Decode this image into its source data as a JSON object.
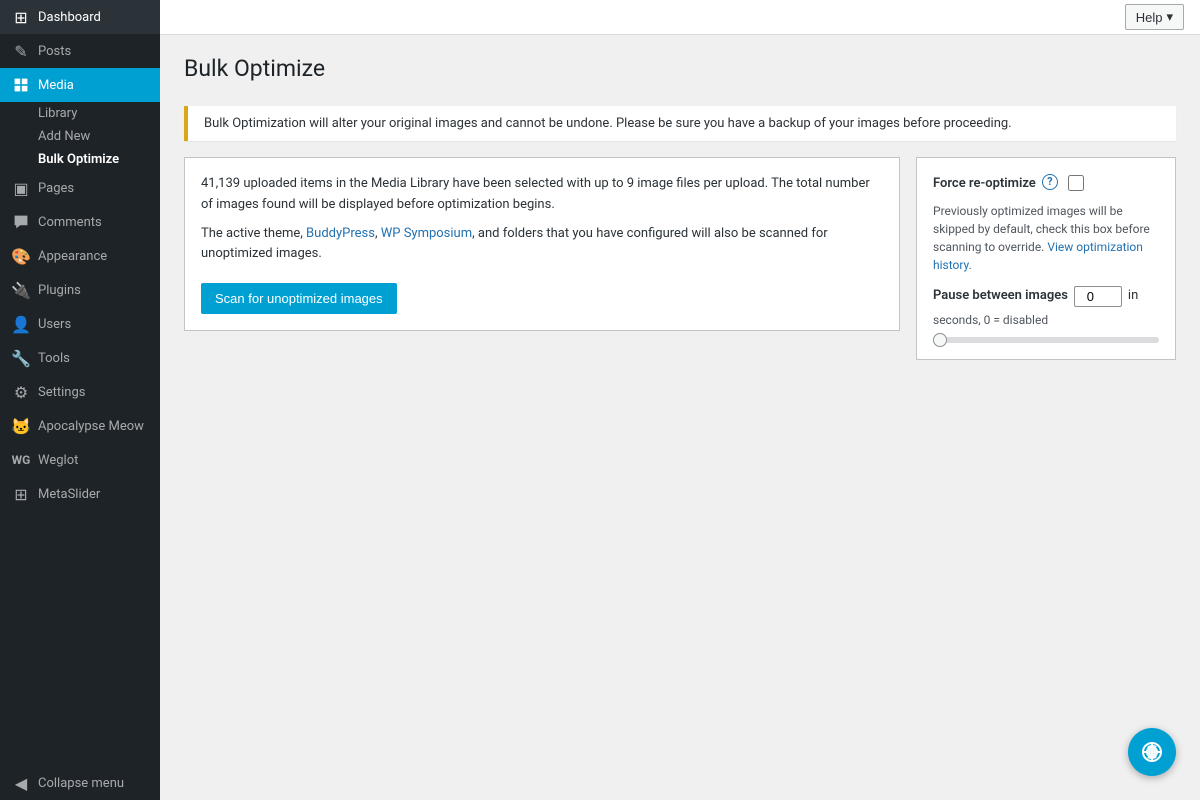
{
  "sidebar": {
    "items": [
      {
        "id": "dashboard",
        "label": "Dashboard",
        "icon": "⊞",
        "active": false
      },
      {
        "id": "posts",
        "label": "Posts",
        "icon": "✎",
        "active": false
      },
      {
        "id": "media",
        "label": "Media",
        "icon": "⊞",
        "active": true
      },
      {
        "id": "pages",
        "label": "Pages",
        "icon": "▣",
        "active": false
      },
      {
        "id": "comments",
        "label": "Comments",
        "icon": "💬",
        "active": false
      },
      {
        "id": "appearance",
        "label": "Appearance",
        "icon": "🎨",
        "active": false
      },
      {
        "id": "plugins",
        "label": "Plugins",
        "icon": "🔌",
        "active": false
      },
      {
        "id": "users",
        "label": "Users",
        "icon": "👤",
        "active": false
      },
      {
        "id": "tools",
        "label": "Tools",
        "icon": "🔧",
        "active": false
      },
      {
        "id": "settings",
        "label": "Settings",
        "icon": "⚙",
        "active": false
      },
      {
        "id": "apocalypse-meow",
        "label": "Apocalypse Meow",
        "icon": "🐱",
        "active": false
      },
      {
        "id": "weglot",
        "label": "Weglot",
        "icon": "W",
        "active": false
      },
      {
        "id": "metaslider",
        "label": "MetaSlider",
        "icon": "⊞",
        "active": false
      }
    ],
    "media_sub": [
      {
        "id": "library",
        "label": "Library",
        "active": false
      },
      {
        "id": "add-new",
        "label": "Add New",
        "active": false
      },
      {
        "id": "bulk-optimize",
        "label": "Bulk Optimize",
        "active": true
      }
    ],
    "collapse_label": "Collapse menu"
  },
  "topbar": {
    "help_label": "Help"
  },
  "page": {
    "title": "Bulk Optimize"
  },
  "notice": {
    "text": "Bulk Optimization will alter your original images and cannot be undone. Please be sure you have a backup of your images before proceeding."
  },
  "info_box": {
    "line1": "41,139 uploaded items in the Media Library have been selected with up to 9 image files per upload. The total number of images found will be displayed before optimization begins.",
    "line2": "The active theme, BuddyPress, WP Symposium, and folders that you have configured will also be scanned for unoptimized images.",
    "buddypress_link": "BuddyPress",
    "wp_symposium_link": "WP Symposium",
    "scan_button_label": "Scan for unoptimized images"
  },
  "options": {
    "force_reoptimize_label": "Force re-optimize",
    "force_reoptimize_desc": "Previously optimized images will be skipped by default, check this box before scanning to override.",
    "view_history_link": "View optimization history.",
    "previously_label": "Previously",
    "pause_label": "Pause between images",
    "pause_value": "0",
    "pause_unit": "in",
    "pause_sub": "seconds, 0 = disabled"
  }
}
